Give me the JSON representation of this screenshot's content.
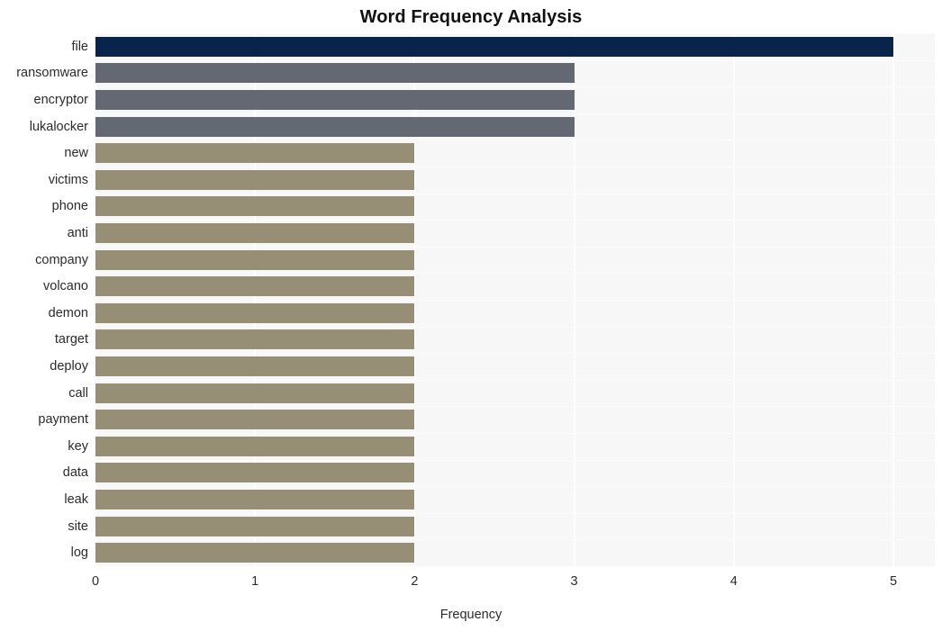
{
  "chart_data": {
    "type": "bar",
    "orientation": "horizontal",
    "title": "Word Frequency Analysis",
    "xlabel": "Frequency",
    "ylabel": "",
    "xlim": [
      0,
      5
    ],
    "xticks": [
      "0",
      "1",
      "2",
      "3",
      "4",
      "5"
    ],
    "grid": true,
    "legend": "none",
    "categories": [
      "file",
      "ransomware",
      "encryptor",
      "lukalocker",
      "new",
      "victims",
      "phone",
      "anti",
      "company",
      "volcano",
      "demon",
      "target",
      "deploy",
      "call",
      "payment",
      "key",
      "data",
      "leak",
      "site",
      "log"
    ],
    "values": [
      5,
      3,
      3,
      3,
      2,
      2,
      2,
      2,
      2,
      2,
      2,
      2,
      2,
      2,
      2,
      2,
      2,
      2,
      2,
      2
    ],
    "bar_colors": [
      "#08244b",
      "#646872",
      "#646872",
      "#646872",
      "#968e75",
      "#968e75",
      "#968e75",
      "#968e75",
      "#968e75",
      "#968e75",
      "#968e75",
      "#968e75",
      "#968e75",
      "#968e75",
      "#968e75",
      "#968e75",
      "#968e75",
      "#968e75",
      "#968e75",
      "#968e75"
    ],
    "palette": {
      "highest": "#08244b",
      "mid": "#646872",
      "low": "#968e75",
      "plot_background": "#f7f7f7",
      "gridline": "#ffffff",
      "text": "#2b2b2b"
    }
  }
}
